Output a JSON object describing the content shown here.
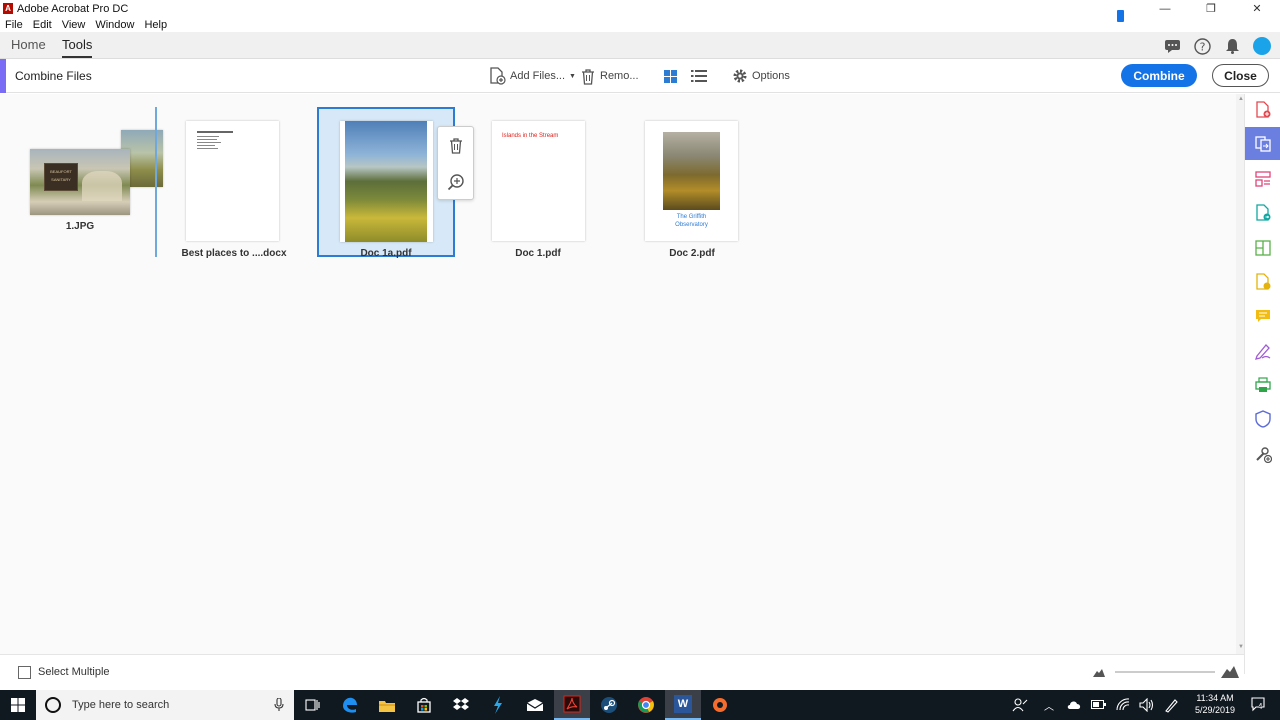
{
  "window": {
    "app_icon_letter": "A",
    "title": "Adobe Acrobat Pro DC",
    "controls": {
      "minimize": "—",
      "maximize": "❐",
      "close": "✕"
    }
  },
  "menu": {
    "items": [
      "File",
      "Edit",
      "View",
      "Window",
      "Help"
    ]
  },
  "nav": {
    "tabs": [
      {
        "label": "Home"
      },
      {
        "label": "Tools"
      }
    ],
    "active_tab": "Tools"
  },
  "toolbar": {
    "title": "Combine Files",
    "add_files_label": "Add Files...",
    "remove_label": "Remo...",
    "options_label": "Options",
    "combine_label": "Combine",
    "close_label": "Close"
  },
  "files": [
    {
      "label": "1.JPG",
      "sign_text_1": "BEAUFORT",
      "sign_text_2": "SANITARY"
    },
    {
      "label": "Best places to ....docx"
    },
    {
      "label": "Doc 1a.pdf",
      "selected": true
    },
    {
      "label": "Doc 1.pdf",
      "page_text": "Islands in the Stream"
    },
    {
      "label": "Doc 2.pdf",
      "page_text_1": "The Griffith",
      "page_text_2": "Observatory"
    }
  ],
  "bottom": {
    "select_multiple_label": "Select Multiple",
    "zoom_level": 0.05
  },
  "taskbar": {
    "search_placeholder": "Type here to search",
    "word_letter": "W",
    "time": "11:34 AM",
    "date": "5/29/2019",
    "notification_count": "4"
  },
  "colors": {
    "accent": "#1473e6",
    "tool_accent": "#7b6cf6",
    "selection_border": "#2d7cd4",
    "selection_fill": "#d7e9f8"
  }
}
